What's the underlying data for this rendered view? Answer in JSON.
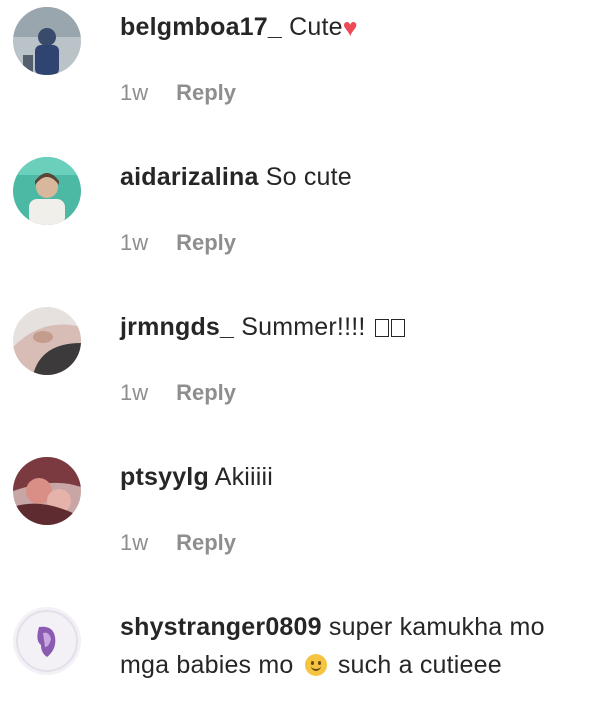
{
  "comments": [
    {
      "username": "belgmboa17_",
      "text": " Cute",
      "suffix_icon": "heart-icon",
      "time": "1w",
      "reply_label": "Reply"
    },
    {
      "username": "aidarizalina",
      "text": " So cute",
      "time": "1w",
      "reply_label": "Reply"
    },
    {
      "username": "jrmngds_",
      "text": " Summer!!!! ",
      "suffix_icon": "missing-glyph-boxes",
      "time": "1w",
      "reply_label": "Reply"
    },
    {
      "username": "ptsyylg",
      "text": " Akiiiii",
      "time": "1w",
      "reply_label": "Reply"
    },
    {
      "username": "shystranger0809",
      "text_before_emoji": " super kamukha mo mga babies mo ",
      "emoji": "smiling-face-icon",
      "text_after_emoji": " such a cutieee"
    }
  ],
  "colors": {
    "text": "#262626",
    "muted": "#8e8e8e",
    "heart": "#ed4956"
  }
}
